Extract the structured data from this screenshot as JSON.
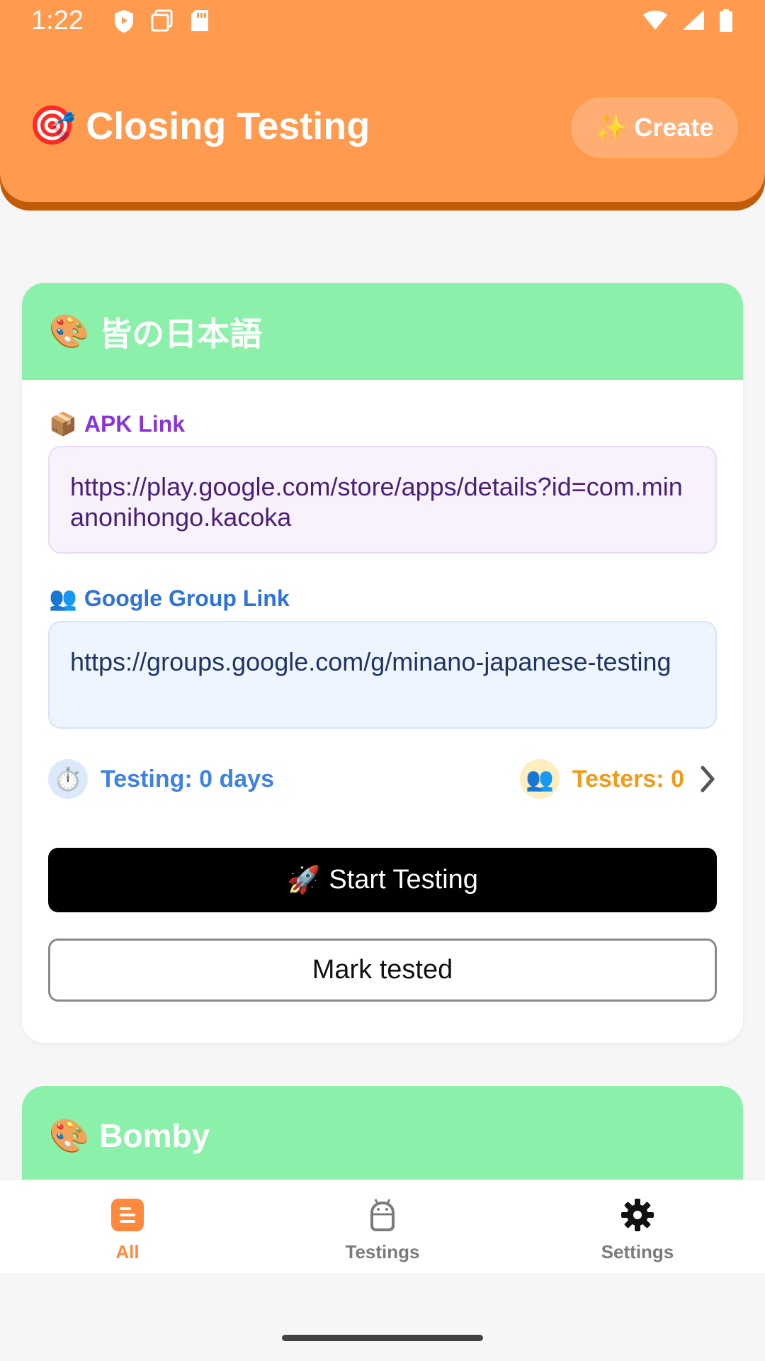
{
  "status_bar": {
    "time": "1:22"
  },
  "header": {
    "icon": "🎯",
    "title": "Closing Testing",
    "create_icon": "✨",
    "create_label": "Create"
  },
  "cards": [
    {
      "icon": "🎨",
      "title": "皆の日本語",
      "apk_label_icon": "📦",
      "apk_label": "APK Link",
      "apk_url": "https://play.google.com/store/apps/details?id=com.minanonihongo.kacoka",
      "group_label_icon": "👥",
      "group_label": "Google Group Link",
      "group_url": "https://groups.google.com/g/minano-japanese-testing",
      "testing_icon": "⏱️",
      "testing_text": "Testing: 0 days",
      "testers_icon": "👥",
      "testers_text": "Testers: 0",
      "start_icon": "🚀",
      "start_label": "Start Testing",
      "mark_label": "Mark tested"
    },
    {
      "icon": "🎨",
      "title": "Bomby"
    }
  ],
  "nav": [
    {
      "label": "All",
      "icon": "list-icon",
      "active": true
    },
    {
      "label": "Testings",
      "icon": "android-icon",
      "active": false
    },
    {
      "label": "Settings",
      "icon": "gear-icon",
      "active": false
    }
  ],
  "colors": {
    "header": "#ff9a4f",
    "card_header": "#8bf0a9",
    "accent": "#ff8a3d"
  }
}
